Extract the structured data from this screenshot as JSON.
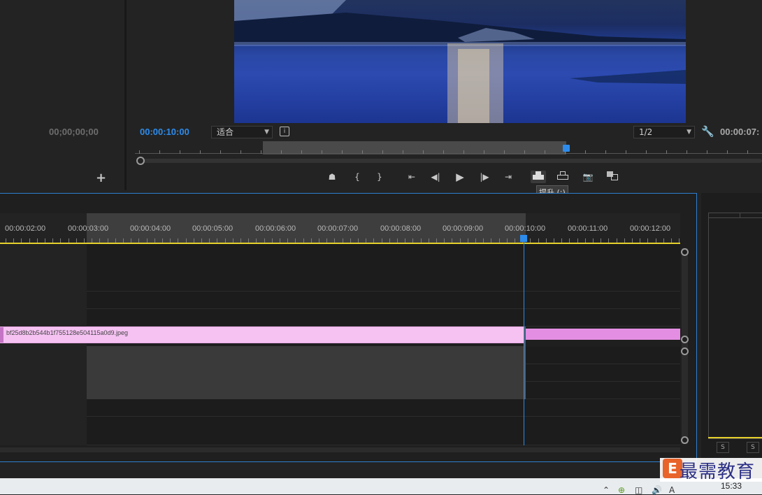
{
  "source_monitor": {
    "timecode": "00;00;00;00",
    "add_label": "+"
  },
  "program_monitor": {
    "timecode": "00:00:10:00",
    "fit_label": "适合",
    "resolution_label": "1/2",
    "end_timecode": "00:00:07:"
  },
  "transport": {
    "tooltip": "提升 (;)",
    "buttons": [
      "marker",
      "mark-in",
      "mark-out",
      "go-to-in",
      "step-back",
      "play",
      "step-forward",
      "go-to-out",
      "lift",
      "extract",
      "export-frame",
      "compare"
    ]
  },
  "timeline": {
    "ruler_labels": [
      "00:00:02:00",
      "00:00:03:00",
      "00:00:04:00",
      "00:00:05:00",
      "00:00:06:00",
      "00:00:07:00",
      "00:00:08:00",
      "00:00:09:00",
      "00:00:10:00",
      "00:00:11:00",
      "00:00:12:00"
    ],
    "clip_name": "bf25d8b2b544b1f755128e504115a0d9.jpeg"
  },
  "audio_meter": {
    "solo_label": "S"
  },
  "taskbar": {
    "time": "15:33"
  },
  "watermark": {
    "logo_letter": "E",
    "text": "最需教育"
  },
  "colors": {
    "accent": "#2d8ceb",
    "clip_pink": "#f5c2f2",
    "clip_magenta": "#e48ee3",
    "ruler_yellow": "#e6d12c"
  }
}
